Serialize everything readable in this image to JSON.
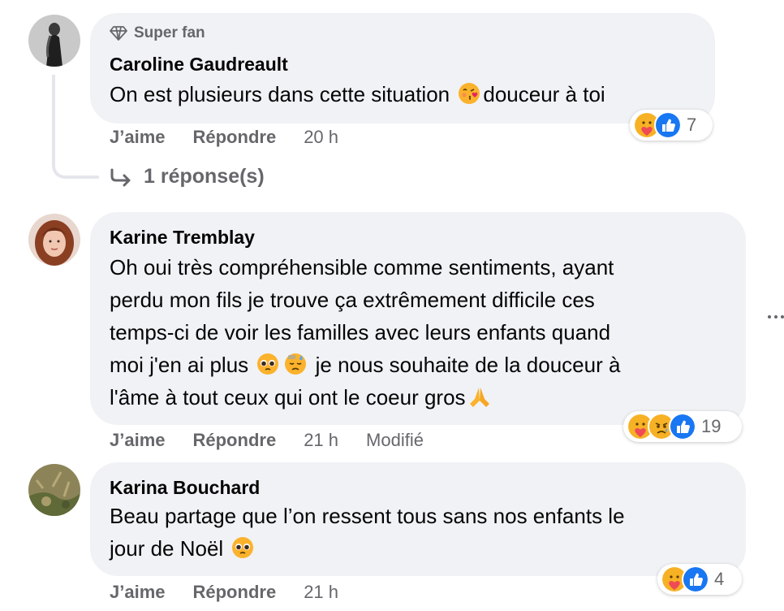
{
  "comments": [
    {
      "badge": "Super fan",
      "author": "Caroline Gaudreault",
      "text_before": "On est plusieurs dans cette situation ",
      "text_emoji": "kissing-heart-emoji",
      "text_after": "douceur à toi",
      "actions": {
        "like": "J’aime",
        "reply": "Répondre",
        "time": "20 h"
      },
      "reactions": {
        "icons": [
          "care",
          "like"
        ],
        "count": "7"
      },
      "replies_label": "1 réponse(s)"
    },
    {
      "author": "Karine Tremblay",
      "lines": [
        "Oh oui très compréhensible comme sentiments, ayant",
        "perdu mon fils je trouve ça extrêmement difficile ces",
        "temps-ci de voir les familles avec leurs enfants quand"
      ],
      "line4_before": "moi j'en ai plus ",
      "line4_after": " je nous souhaite de la douceur à",
      "line5": "l'âme à tout ceux qui ont le coeur gros",
      "actions": {
        "like": "J’aime",
        "reply": "Répondre",
        "time": "21 h",
        "edited": "Modifié"
      },
      "reactions": {
        "icons": [
          "care",
          "sad",
          "like"
        ],
        "count": "19"
      }
    },
    {
      "author": "Karina Bouchard",
      "line1": "Beau partage que l’on ressent tous sans nos enfants le",
      "line2": "jour de Noël ",
      "actions": {
        "like": "J’aime",
        "reply": "Répondre",
        "time": "21 h"
      },
      "reactions": {
        "icons": [
          "care",
          "like"
        ],
        "count": "4"
      }
    }
  ],
  "colors": {
    "bubble": "#f0f2f5",
    "muted": "#65676b",
    "text": "#050505",
    "like_blue": "#1877f2"
  }
}
